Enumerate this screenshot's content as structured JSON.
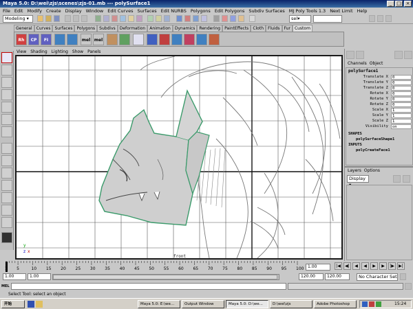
{
  "window": {
    "title": "Maya 5.0: D:\\wei\\zjs\\scenes\\zjs-01.mb  ---  polySurface1",
    "controls": [
      "_",
      "□",
      "×"
    ]
  },
  "menubar": [
    "File",
    "Edit",
    "Modify",
    "Create",
    "Display",
    "Window",
    "Edit Curves",
    "Surfaces",
    "Edit NURBS",
    "Polygons",
    "Edit Polygons",
    "Subdiv Surfaces",
    "MJ Poly Tools 1.3",
    "Next Limit",
    "Help"
  ],
  "statusline": {
    "mode": "Modeling",
    "select_label": "sel▾"
  },
  "shelf": {
    "tabs": [
      "General",
      "Curves",
      "Surfaces",
      "Polygons",
      "Subdivs",
      "Deformation",
      "Animation",
      "Dynamics",
      "Rendering",
      "PaintEffects",
      "Cloth",
      "Fluids",
      "Fur",
      "Custom"
    ],
    "active_tab": "Custom",
    "icons": [
      "Rh",
      "CP",
      "FI",
      "",
      "",
      "mel",
      "mel",
      "",
      "",
      "",
      "",
      "",
      "",
      "",
      "",
      ""
    ]
  },
  "panel_menu": [
    "View",
    "Shading",
    "Lighting",
    "Show",
    "Panels"
  ],
  "viewport": {
    "camera_label": "front",
    "axis_y": "y",
    "axis_z": "z",
    "axis_x": "x"
  },
  "channel_box": {
    "menu": [
      "Channels",
      "Object"
    ],
    "object": "polySurface1",
    "attributes": [
      {
        "name": "Translate X",
        "value": "0"
      },
      {
        "name": "Translate Y",
        "value": "0"
      },
      {
        "name": "Translate Z",
        "value": "0"
      },
      {
        "name": "Rotate X",
        "value": "0"
      },
      {
        "name": "Rotate Y",
        "value": "0"
      },
      {
        "name": "Rotate Z",
        "value": "0"
      },
      {
        "name": "Scale X",
        "value": "1"
      },
      {
        "name": "Scale Y",
        "value": "1"
      },
      {
        "name": "Scale Z",
        "value": "1"
      },
      {
        "name": "Visibility",
        "value": "on"
      }
    ],
    "shapes_header": "SHAPES",
    "shape_node": "polySurfaceShape1",
    "inputs_header": "INPUTS",
    "input_node": "polyCreateFace1"
  },
  "layers": {
    "menu": [
      "Layers",
      "Options"
    ],
    "display_value": "Display"
  },
  "time_slider": {
    "ticks": [
      "1",
      "5",
      "10",
      "15",
      "20",
      "25",
      "30",
      "35",
      "40",
      "45",
      "50",
      "55",
      "60",
      "65",
      "70",
      "75",
      "80",
      "85",
      "90",
      "95",
      "100"
    ],
    "current_frame": "1.00"
  },
  "range_slider": {
    "start": "1.00",
    "playback_start": "1.00",
    "playback_end": "120.00",
    "end": "120.00",
    "character_set": "No Character Set"
  },
  "command_line": {
    "label": "MEL"
  },
  "help_line": "Select Tool: select an object",
  "taskbar": {
    "start_label": "开始",
    "tasks": [
      {
        "label": "Maya 5.0: E:\\we...",
        "active": false
      },
      {
        "label": "Output Window",
        "active": false
      },
      {
        "label": "Maya 5.0: D:\\we...",
        "active": true
      },
      {
        "label": "D:\\wei\\zjs",
        "active": false
      },
      {
        "label": "Adobe Photoshop",
        "active": false
      }
    ],
    "clock": "15:24"
  }
}
